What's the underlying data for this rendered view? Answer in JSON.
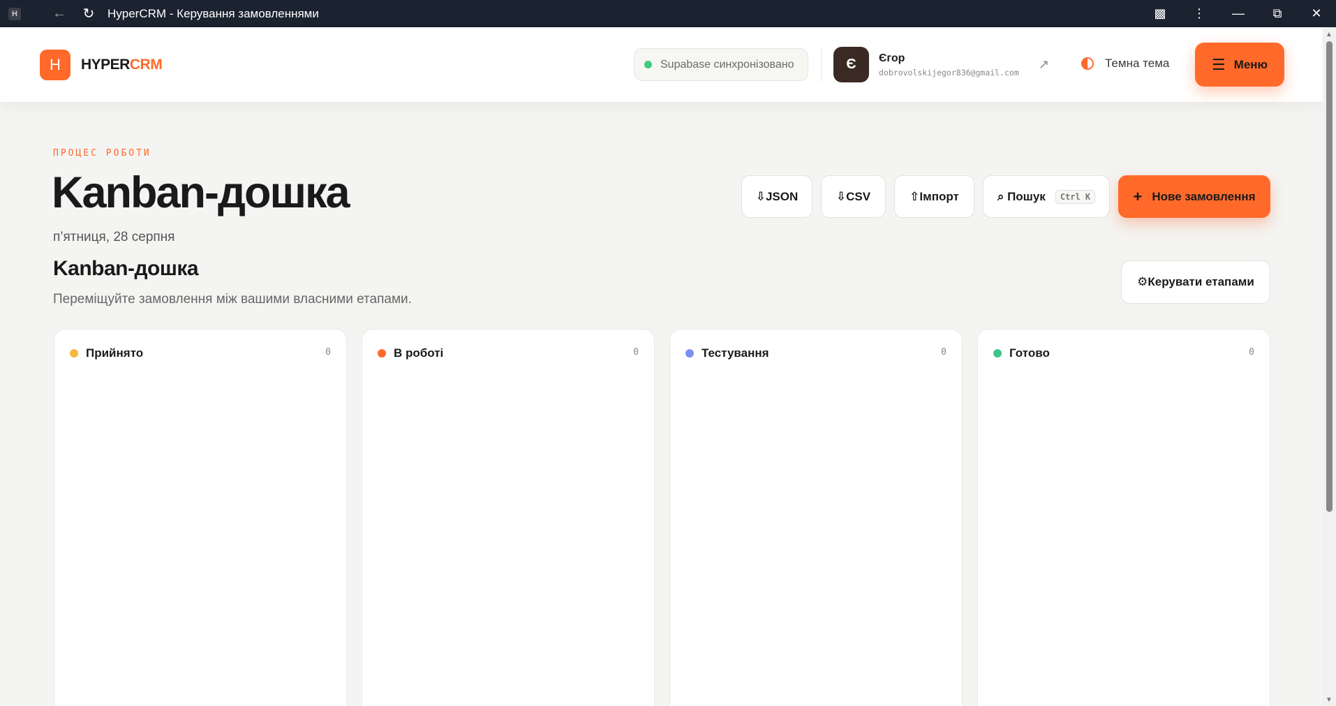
{
  "browser": {
    "favicon": "H",
    "title": "HyperCRM - Керування замовленнями",
    "icons": [
      "back-icon",
      "reload-icon",
      "extensions-icon",
      "kebab-icon",
      "minimize-icon",
      "restore-icon",
      "close-icon"
    ]
  },
  "header": {
    "logo_mark": "H",
    "logo_part1": "HYPER",
    "logo_part2": "CRM",
    "sync_status": "Supabase синхронізовано",
    "user": {
      "avatar_letter": "Є",
      "name": "Єгор",
      "email": "dobrovolskijegor836@gmail.com"
    },
    "theme_label": "Темна тема",
    "menu_label": "Меню"
  },
  "page": {
    "eyebrow": "ПРОЦЕС РОБОТИ",
    "title": "Kanban-дошка",
    "date": "п’ятниця, 28 серпня",
    "section_title": "Kanban-дошка",
    "section_subtitle": "Переміщуйте замовлення між вашими власними етапами."
  },
  "toolbar": {
    "json_label": "⇩JSON",
    "csv_label": "⇩CSV",
    "import_label": "⇧Імпорт",
    "search_label": "⌕ Пошук",
    "search_shortcut": "Ctrl K",
    "new_order_label": "Нове замовлення",
    "manage_stages_label": "⚙Керувати етапами"
  },
  "columns": [
    {
      "title": "Прийнято",
      "count": "0",
      "color": "#f5b83d"
    },
    {
      "title": "В роботі",
      "count": "0",
      "color": "#ff6a2b"
    },
    {
      "title": "Тестування",
      "count": "0",
      "color": "#7b8ff0"
    },
    {
      "title": "Готово",
      "count": "0",
      "color": "#3ec48a"
    }
  ],
  "colors": {
    "accent": "#ff6a2b",
    "sync_dot": "#3ecb7f"
  }
}
